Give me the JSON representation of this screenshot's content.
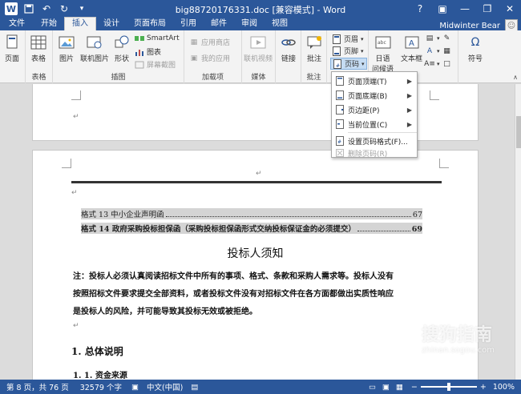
{
  "window": {
    "title": "big88720176331.doc [兼容模式] - Word",
    "controls": {
      "help": "?",
      "ribbon_display": "▣",
      "minimize": "—",
      "restore": "❐",
      "close": "✕"
    }
  },
  "quick_access": {
    "save_icon": "save-icon",
    "undo_icon": "undo-icon",
    "redo_icon": "redo-icon"
  },
  "tabs": [
    "文件",
    "开始",
    "插入",
    "设计",
    "页面布局",
    "引用",
    "邮件",
    "审阅",
    "视图"
  ],
  "active_tab": "插入",
  "user": {
    "name": "Midwinter Bear"
  },
  "ribbon": {
    "groups": [
      {
        "label": "",
        "buttons": [
          "页面"
        ]
      },
      {
        "label": "表格",
        "buttons": [
          "表格"
        ]
      },
      {
        "label": "插图",
        "buttons": [
          "图片",
          "联机图片",
          "形状"
        ],
        "small": [
          "SmartArt",
          "图表",
          "屏幕截图"
        ]
      },
      {
        "label": "加载项",
        "small": [
          "应用商店",
          "我的应用"
        ]
      },
      {
        "label": "媒体",
        "buttons": [
          "联机视频"
        ]
      },
      {
        "label": "",
        "buttons": [
          "链接"
        ]
      },
      {
        "label": "批注",
        "buttons": [
          "批注"
        ]
      },
      {
        "label": "",
        "small": [
          "页眉",
          "页脚",
          "页码"
        ]
      },
      {
        "label": "",
        "buttons": [
          "日期",
          "问候语"
        ]
      },
      {
        "label": "本框",
        "buttons": [
          "文本框"
        ]
      },
      {
        "label": "",
        "buttons": [
          "符号"
        ]
      }
    ],
    "header_footer_label": "页码",
    "date_label": "日语",
    "greeting_label": "问候语",
    "textbox_label": "文本框",
    "symbol_label": "符号",
    "text_group_label": "本框"
  },
  "dropdown": {
    "items": [
      {
        "label": "页面顶端(T)",
        "submenu": true,
        "enabled": true
      },
      {
        "label": "页面底端(B)",
        "submenu": true,
        "enabled": true
      },
      {
        "label": "页边距(P)",
        "submenu": true,
        "enabled": true
      },
      {
        "label": "当前位置(C)",
        "submenu": true,
        "enabled": true
      },
      {
        "label": "设置页码格式(F)...",
        "submenu": false,
        "enabled": true
      },
      {
        "label": "删除页码(R)",
        "submenu": false,
        "enabled": false
      }
    ]
  },
  "document": {
    "toc": [
      {
        "title": "格式 13 中小企业声明函",
        "page": "67"
      },
      {
        "title": "格式 14 政府采购投标担保函（采购投标担保函形式交纳投标保证金的必须提交）",
        "page": "69"
      }
    ],
    "heading": "投标人须知",
    "note": [
      "注：投标人必须认真阅读招标文件中所有的事项、格式、条款和采购人需求等。投标人没有",
      "按照招标文件要求提交全部资料，或者投标文件没有对招标文件在各方面都做出实质性响应",
      "是投标人的风险，并可能导致其投标无效或被拒绝。"
    ],
    "section1": "1.   总体说明",
    "section11": "1. 1. 资金来源",
    "para_mark": "↵"
  },
  "status": {
    "page": "第 8 页，共 76 页",
    "words": "32579 个字",
    "lang": "中文(中国)",
    "zoom": "100%"
  },
  "watermark": {
    "text": "搜狗指南",
    "sub": "zhinan.sogou.com"
  },
  "colors": {
    "accent": "#2b579a",
    "ribbon_bg": "#f3f3f3",
    "highlight": "#c5dcf3"
  }
}
